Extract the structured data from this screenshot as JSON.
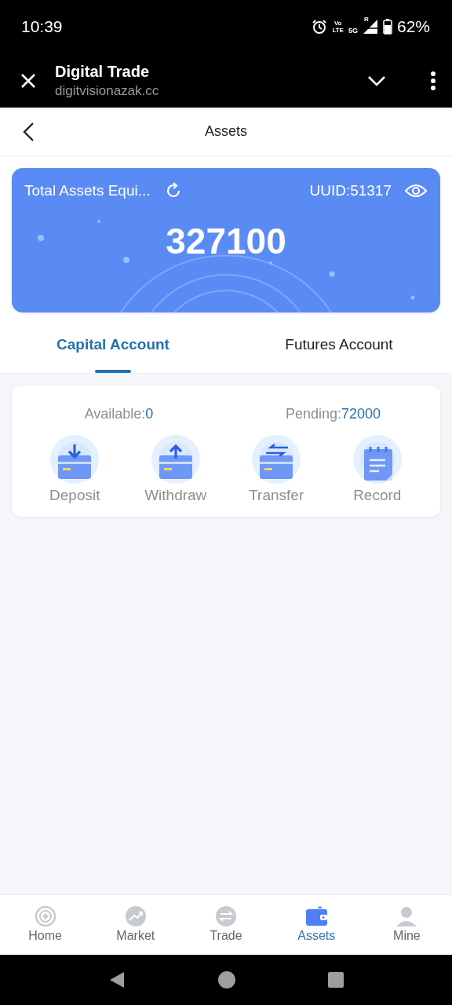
{
  "status_bar": {
    "time": "10:39",
    "volte_top": "Vo",
    "volte_bottom": "LTE",
    "network": "5G",
    "roaming": "R",
    "battery": "62%"
  },
  "browser": {
    "title": "Digital Trade",
    "url": "digitvisionazak.cc"
  },
  "header": {
    "title": "Assets"
  },
  "summary": {
    "label": "Total Assets Equi...",
    "uuid": "UUID:51317",
    "total": "327100"
  },
  "tabs": [
    {
      "label": "Capital Account",
      "selected": true
    },
    {
      "label": "Futures Account",
      "selected": false
    }
  ],
  "balances": [
    {
      "label": "Available:",
      "value": "0"
    },
    {
      "label": "Pending:",
      "value": "72000"
    }
  ],
  "actions": [
    {
      "kind": "deposit",
      "label": "Deposit"
    },
    {
      "kind": "withdraw",
      "label": "Withdraw"
    },
    {
      "kind": "transfer",
      "label": "Transfer"
    },
    {
      "kind": "record",
      "label": "Record"
    }
  ],
  "bottom_nav": [
    {
      "kind": "home",
      "label": "Home",
      "selected": false
    },
    {
      "kind": "market",
      "label": "Market",
      "selected": false
    },
    {
      "kind": "trade",
      "label": "Trade",
      "selected": false
    },
    {
      "kind": "assets",
      "label": "Assets",
      "selected": true
    },
    {
      "kind": "mine",
      "label": "Mine",
      "selected": false
    }
  ]
}
